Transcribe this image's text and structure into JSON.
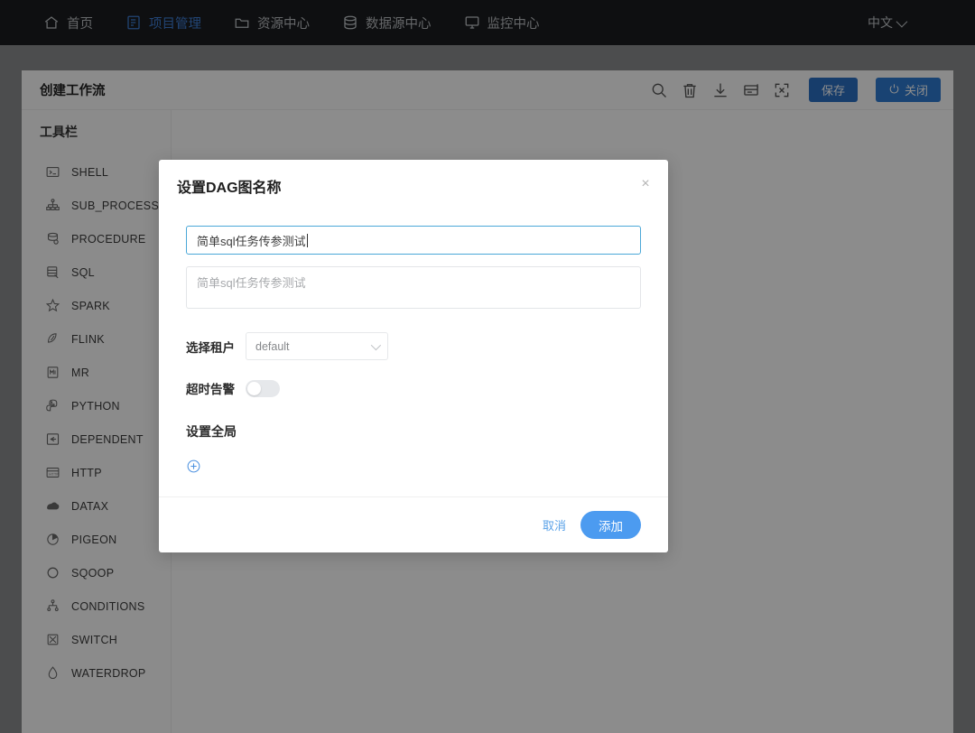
{
  "topnav": {
    "items": [
      {
        "label": "首页",
        "icon": "home-icon",
        "active": false
      },
      {
        "label": "项目管理",
        "icon": "project-icon",
        "active": true
      },
      {
        "label": "资源中心",
        "icon": "folder-icon",
        "active": false
      },
      {
        "label": "数据源中心",
        "icon": "database-icon",
        "active": false
      },
      {
        "label": "监控中心",
        "icon": "monitor-icon",
        "active": false
      }
    ],
    "language": "中文",
    "active_color": "#3f7fd6"
  },
  "card": {
    "title": "创建工作流",
    "tools": [
      {
        "name": "search-icon"
      },
      {
        "name": "trash-icon"
      },
      {
        "name": "download-icon"
      },
      {
        "name": "format-icon"
      },
      {
        "name": "fullscreen-icon"
      }
    ],
    "save_label": "保存",
    "close_label": "关闭",
    "save_color": "#2a6fc4",
    "close_color": "#2f7ad1"
  },
  "toolbar": {
    "title": "工具栏",
    "items": [
      {
        "label": "SHELL",
        "icon": "shell-icon"
      },
      {
        "label": "SUB_PROCESS",
        "icon": "sub-process-icon"
      },
      {
        "label": "PROCEDURE",
        "icon": "procedure-icon"
      },
      {
        "label": "SQL",
        "icon": "sql-icon"
      },
      {
        "label": "SPARK",
        "icon": "spark-icon"
      },
      {
        "label": "FLINK",
        "icon": "flink-icon"
      },
      {
        "label": "MR",
        "icon": "mr-icon"
      },
      {
        "label": "PYTHON",
        "icon": "python-icon"
      },
      {
        "label": "DEPENDENT",
        "icon": "dependent-icon"
      },
      {
        "label": "HTTP",
        "icon": "http-icon"
      },
      {
        "label": "DATAX",
        "icon": "datax-icon"
      },
      {
        "label": "PIGEON",
        "icon": "pigeon-icon"
      },
      {
        "label": "SQOOP",
        "icon": "sqoop-icon"
      },
      {
        "label": "CONDITIONS",
        "icon": "conditions-icon"
      },
      {
        "label": "SWITCH",
        "icon": "switch-icon"
      },
      {
        "label": "WATERDROP",
        "icon": "waterdrop-icon"
      }
    ]
  },
  "modal": {
    "title": "设置DAG图名称",
    "close_icon": "×",
    "name_value": "简单sql任务传参测试",
    "description_placeholder": "简单sql任务传参测试",
    "description_value": "",
    "tenant_label": "选择租户",
    "tenant_value": "default",
    "tenant_options": [
      "default"
    ],
    "timeout_label": "超时告警",
    "timeout_enabled": false,
    "global_label": "设置全局",
    "add_param_icon": "plus-circle-icon",
    "cancel_label": "取消",
    "confirm_label": "添加",
    "confirm_color": "#4c9bf0",
    "link_color": "#5aa2e8",
    "focus_border_color": "#4ba8d8"
  }
}
